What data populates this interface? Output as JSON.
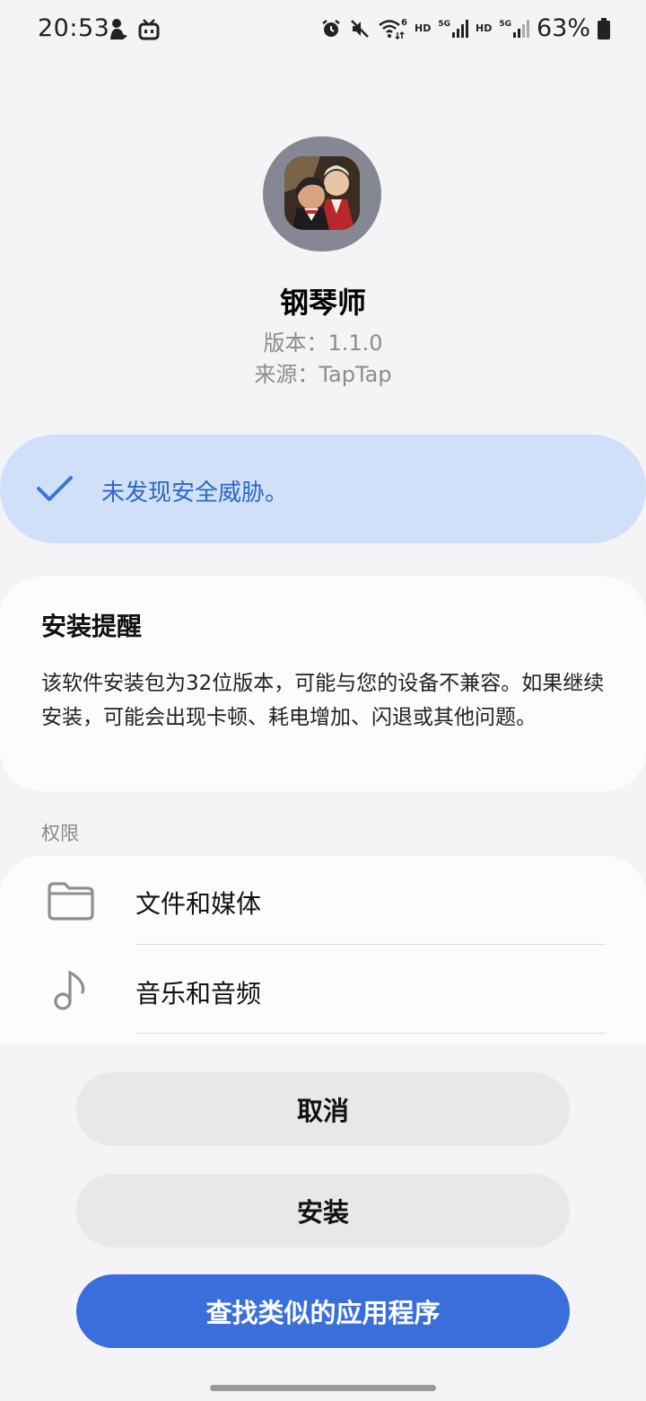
{
  "status_bar": {
    "time": "20:53",
    "battery_percent": "63%",
    "network_labels": [
      "HD",
      "5G",
      "HD",
      "5G"
    ],
    "wifi_badge": "6",
    "left_icons": [
      "notification-person-icon",
      "tv-app-icon"
    ],
    "right_icons": [
      "alarm-icon",
      "mute-icon",
      "wifi-icon",
      "signal-icon",
      "signal-icon",
      "battery-icon"
    ]
  },
  "app": {
    "name": "钢琴师",
    "version": "版本：1.1.0",
    "source": "来源：TapTap",
    "icon": "composer-portrait-icon"
  },
  "security": {
    "message": "未发现安全威胁。",
    "icon": "checkmark-icon",
    "color": "#2f67c4",
    "background": "#cfe0f8"
  },
  "notice": {
    "title": "安装提醒",
    "body": "该软件安装包为32位版本，可能与您的设备不兼容。如果继续安装，可能会出现卡顿、耗电增加、闪退或其他问题。"
  },
  "permissions": {
    "section_label": "权限",
    "items": [
      {
        "label": "文件和媒体",
        "icon": "folder-icon"
      },
      {
        "label": "音乐和音频",
        "icon": "music-note-icon"
      }
    ]
  },
  "buttons": {
    "cancel": "取消",
    "install": "安装",
    "find_similar": "查找类似的应用程序",
    "accent": "#3a6fdb"
  }
}
